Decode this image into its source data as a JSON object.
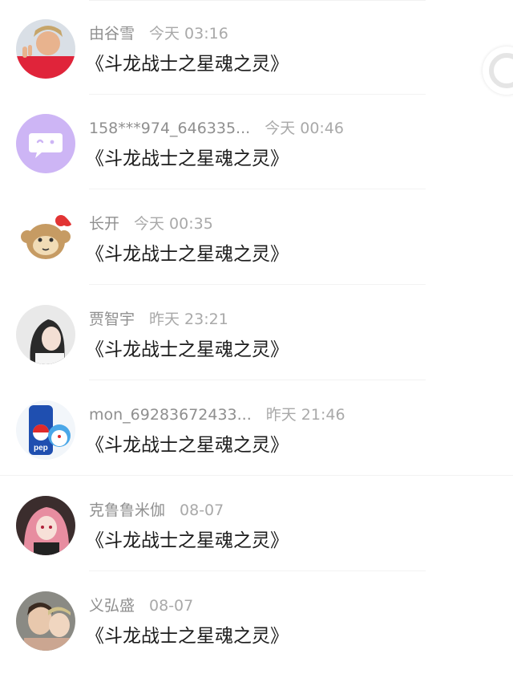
{
  "comments": [
    {
      "name": "由谷雪",
      "time": "今天 03:16",
      "message": "《斗龙战士之星魂之灵》",
      "avatar": "photo-avatar-icon"
    },
    {
      "name": "158***974_646335...",
      "time": "今天 00:46",
      "message": "《斗龙战士之星魂之灵》",
      "avatar": "chat-bubble-avatar-icon"
    },
    {
      "name": "长开",
      "time": "今天 00:35",
      "message": "《斗龙战士之星魂之灵》",
      "avatar": "cartoon-monkey-avatar-icon"
    },
    {
      "name": "贾智宇",
      "time": "昨天 23:21",
      "message": "《斗龙战士之星魂之灵》",
      "avatar": "photo-avatar-icon"
    },
    {
      "name": "mon_69283672433...",
      "time": "昨天 21:46",
      "message": "《斗龙战士之星魂之灵》",
      "avatar": "pepsi-doraemon-avatar-icon"
    },
    {
      "name": "克鲁鲁米伽",
      "time": "08-07",
      "message": "《斗龙战士之星魂之灵》",
      "avatar": "anime-avatar-icon"
    },
    {
      "name": "义弘盛",
      "time": "08-07",
      "message": "《斗龙战士之星魂之灵》",
      "avatar": "photo-avatar-icon"
    }
  ],
  "colors": {
    "name": "#8f8f8f",
    "time": "#a9a9a9",
    "message": "#1c1c1c",
    "chat_bubble_bg": "#cdb5f5"
  }
}
